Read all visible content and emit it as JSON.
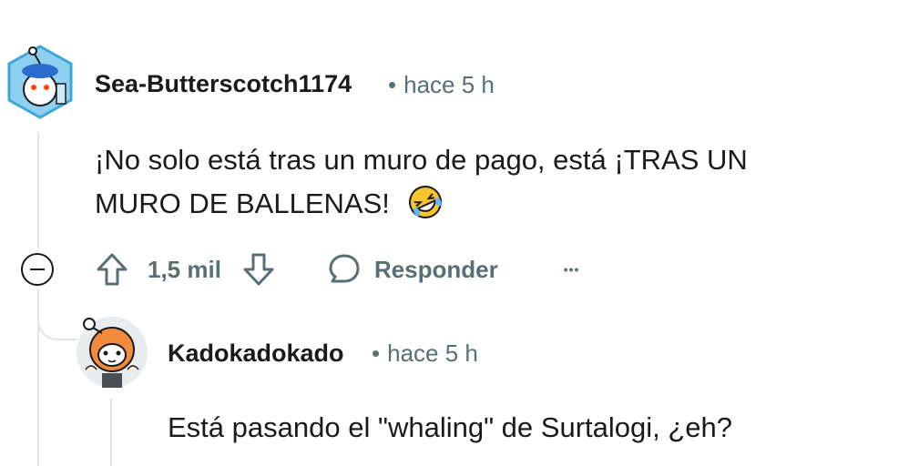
{
  "comments": [
    {
      "username": "Sea-Butterscotch1174",
      "separator": "•",
      "time": "hace 5 h",
      "text": "¡No solo está tras un muro de pago, está ¡TRAS UN MURO DE BALLENAS!",
      "emoji": "rolling-on-floor-laughing",
      "votes": "1,5 mil",
      "reply_label": "Responder",
      "more_label": "•••"
    },
    {
      "username": "Kadokadokado",
      "separator": "•",
      "time": "hace 5 h",
      "text": "Está pasando el \"whaling\" de Surtalogi, ¿eh?"
    }
  ],
  "colors": {
    "meta": "#576f76",
    "thread": "#e1e3e6",
    "text": "#1a1a1b"
  }
}
